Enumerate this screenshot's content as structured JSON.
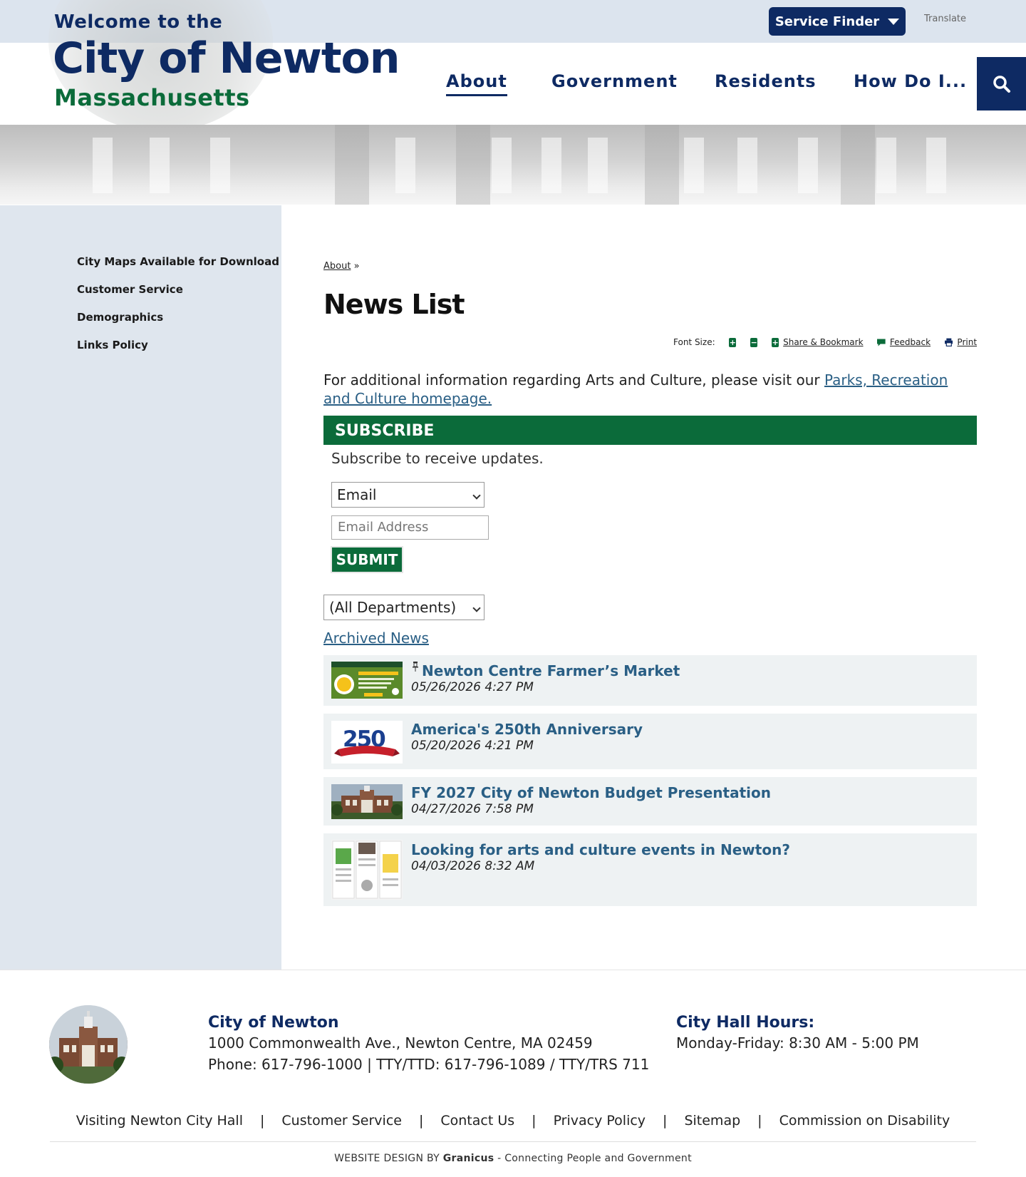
{
  "header": {
    "service_finder": "Service Finder",
    "translate": "Translate",
    "welcome": "Welcome to the",
    "city": "City of Newton",
    "state": "Massachusetts"
  },
  "nav": {
    "items": [
      "About",
      "Government",
      "Residents",
      "How Do I..."
    ],
    "active": "About"
  },
  "sidebar": {
    "items": [
      "City Maps Available for Download",
      "Customer Service",
      "Demographics",
      "Links Policy"
    ]
  },
  "breadcrumb": {
    "link": "About",
    "sep": "»"
  },
  "page_title": "News List",
  "tools": {
    "font_size": "Font Size:",
    "share": "Share & Bookmark",
    "feedback": "Feedback",
    "print": "Print"
  },
  "intro": {
    "text": "For additional information regarding Arts and Culture, please visit our ",
    "link": "Parks, Recreation and Culture homepage."
  },
  "subscribe": {
    "heading": "SUBSCRIBE",
    "text": "Subscribe to receive updates.",
    "method": "Email",
    "email_placeholder": "Email Address",
    "submit": "SUBMIT"
  },
  "filter": {
    "department": "(All Departments)"
  },
  "archived_link": "Archived News",
  "news": [
    {
      "title": "Newton Centre Farmer’s Market",
      "date": "05/26/2026 4:27 PM",
      "pinned": true
    },
    {
      "title": "America's 250th Anniversary",
      "date": "05/20/2026 4:21 PM",
      "pinned": false
    },
    {
      "title": "FY 2027 City of Newton Budget Presentation",
      "date": "04/27/2026 7:58 PM",
      "pinned": false
    },
    {
      "title": "Looking for arts and culture events in Newton?",
      "date": "04/03/2026 8:32 AM",
      "pinned": false
    }
  ],
  "thumb_250": "250",
  "footer": {
    "name": "City of Newton",
    "address": "1000 Commonwealth Ave., Newton Centre, MA 02459",
    "phone": "Phone: 617-796-1000 | TTY/TTD: 617-796-1089 / TTY/TRS 711",
    "hours_title": "City Hall Hours:",
    "hours": "Monday-Friday: 8:30 AM - 5:00 PM",
    "links": [
      "Visiting Newton City Hall",
      "Customer Service",
      "Contact Us",
      "Privacy Policy",
      "Sitemap",
      "Commission on Disability"
    ],
    "link_sep": "|",
    "credit_prefix": "WEBSITE DESIGN BY",
    "credit_brand": "Granicus",
    "credit_suffix": "- Connecting People and Government"
  },
  "colors": {
    "navy": "#0e2a63",
    "green": "#0b6b3a",
    "link": "#2a5f85",
    "sidebar": "#dfe6ee"
  }
}
